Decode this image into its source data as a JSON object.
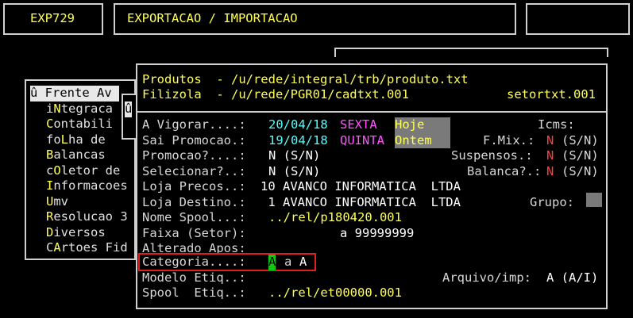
{
  "header": {
    "code": "EXP729",
    "title": "EXPORTACAO / IMPORTACAO"
  },
  "menu": {
    "first": "û Frente Av",
    "items": [
      {
        "hot": "i",
        "key": "N",
        "rest": "tegraca",
        "pre": ""
      },
      {
        "hot": "C",
        "rest": "ontabili"
      },
      {
        "pre": "fo",
        "hot": "L",
        "rest": "ha de"
      },
      {
        "hot": "B",
        "rest": "alancas"
      },
      {
        "pre": "c",
        "hot": "O",
        "rest": "letor de"
      },
      {
        "hot": "I",
        "rest": "nformacoes"
      },
      {
        "hot": "U",
        "rest": "mv"
      },
      {
        "hot": "R",
        "rest": "esolucao 3"
      },
      {
        "hot": "D",
        "rest": "iversos"
      },
      {
        "pre": "C",
        "hot": "A",
        "rest": "rtoes Fid"
      }
    ],
    "marker": "û"
  },
  "paths": {
    "produtos": "Produtos  - /u/rede/integral/trb/produto.txt",
    "filizola": "Filizola  - /u/rede/PGR01/cadtxt.001",
    "setor": "setortxt.001"
  },
  "form": {
    "a_vigorar_label": "A Vigorar....:",
    "a_vigorar_date": "20/04/18",
    "a_vigorar_day": "SEXTA",
    "a_vigorar_hint": "Hoje ",
    "icms_label": "Icms:",
    "sai_label": "Sai Promocao.:",
    "sai_date": "19/04/18",
    "sai_day": "QUINTA",
    "sai_hint": "Ontem ",
    "fmix_label": "F.Mix.:",
    "fmix_value": "N",
    "fmix_opts": "(S/N)",
    "promocao_label": "Promocao?....:",
    "promocao_value": "N (S/N)",
    "suspensos_label": "Suspensos.:",
    "suspensos_value": "N",
    "suspensos_opts": "(S/N)",
    "selecionar_label": "Selecionar?..:",
    "selecionar_value": "N (S/N)",
    "balanca_label": "Balanca?.:",
    "balanca_value": "N",
    "balanca_opts": "(S/N)",
    "loja_precos_label": "Loja Precos..:",
    "loja_precos_value": "10 AVANCO INFORMATICA  LTDA",
    "loja_destino_label": "Loja Destino.:",
    "loja_destino_value": " 1 AVANCO INFORMATICA  LTDA",
    "grupo_label": "Grupo:",
    "nome_spool_label": "Nome Spool...:",
    "nome_spool_value": "../rel/p180420.001",
    "faixa_label": "Faixa (Setor):",
    "faixa_value": "a 99999999",
    "alterado_label": "Alterado Apos:",
    "categoria_label": "Categoria....:",
    "categoria_from": "A",
    "categoria_sep": "a",
    "categoria_to": "A",
    "modelo_label": "Modelo Etiq..:",
    "arquivo_label": "Arquivo/imp:",
    "arquivo_value": "A (A/I)",
    "spool_label": "Spool  Etiq..:",
    "spool_value": "../rel/et00000.001"
  },
  "colors": {
    "yellow": "#ffff54",
    "cyan": "#54ffff",
    "magenta": "#ff54ff",
    "red": "#ff4040",
    "cursor": "#12c712",
    "highlight_box": "#e02020"
  }
}
